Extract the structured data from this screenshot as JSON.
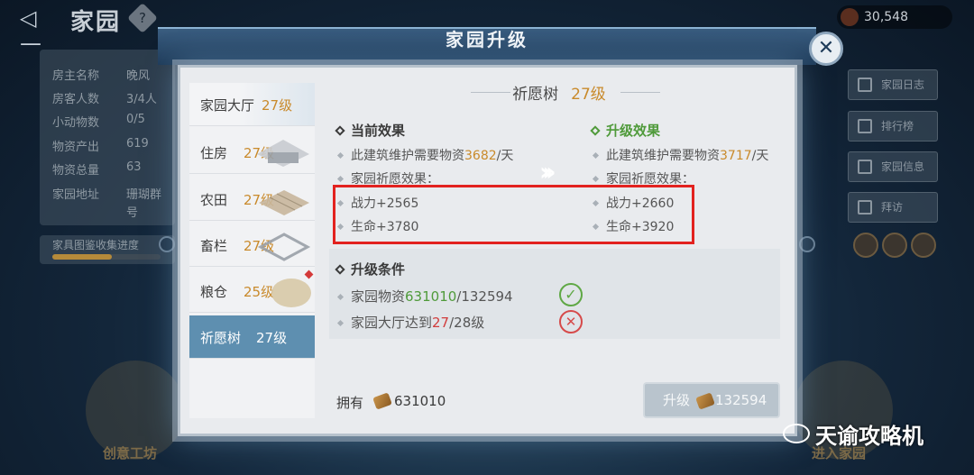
{
  "topbar": {
    "back_icon": "back-arrow-icon",
    "title": "家园",
    "help": "?",
    "currency_value": "30,548"
  },
  "info_panel": {
    "rows": [
      {
        "label": "房主名称",
        "value": "晚风"
      },
      {
        "label": "房客人数",
        "value": "3/4人"
      },
      {
        "label": "小动物数",
        "value": "0/5"
      },
      {
        "label": "物资产出",
        "value": "619"
      },
      {
        "label": "物资总量",
        "value": "63"
      },
      {
        "label": "家园地址",
        "value": "珊瑚群"
      }
    ],
    "extra": "号",
    "progress_label": "家具图鉴收集进度",
    "progress_fraction": 0.55
  },
  "side_buttons": [
    "家园日志",
    "排行榜",
    "家园信息",
    "拜访"
  ],
  "bottom": {
    "left": "创意工坊",
    "right": "进入家园"
  },
  "modal": {
    "title": "家园升级",
    "close": "✕",
    "list": [
      {
        "name": "家园大厅",
        "level": "27级"
      },
      {
        "name": "住房",
        "level": "27级"
      },
      {
        "name": "农田",
        "level": "27级"
      },
      {
        "name": "畜栏",
        "level": "27级"
      },
      {
        "name": "粮仓",
        "level": "25级"
      },
      {
        "name": "祈愿树",
        "level": "27级"
      }
    ],
    "building": {
      "name": "祈愿树",
      "level": "27级"
    },
    "current": {
      "title": "当前效果",
      "maint_prefix": "此建筑维护需要物资",
      "maint_value": "3682",
      "maint_suffix": "/天",
      "wish_label": "家园祈愿效果：",
      "power": "战力+2565",
      "hp": "生命+3780"
    },
    "upgrade": {
      "title": "升级效果",
      "maint_prefix": "此建筑维护需要物资",
      "maint_value": "3717",
      "maint_suffix": "/天",
      "wish_label": "家园祈愿效果：",
      "power": "战力+2660",
      "hp": "生命+3920"
    },
    "conditions": {
      "title": "升级条件",
      "c1_prefix": "家园物资",
      "c1_have": "631010",
      "c1_need": "/132594",
      "c2_prefix": "家园大厅达到",
      "c2_have": "27",
      "c2_need": "/28级"
    },
    "own_label": "拥有",
    "own_value": "631010",
    "upgrade_btn_label": "升级",
    "upgrade_btn_cost": "132594"
  },
  "watermark": "天谕攻略机",
  "colors": {
    "accent": "#c98a2b",
    "ok": "#4f9a3a",
    "bad": "#d13c3c",
    "highlight": "#e2221f",
    "selected": "#5e8fb0"
  }
}
